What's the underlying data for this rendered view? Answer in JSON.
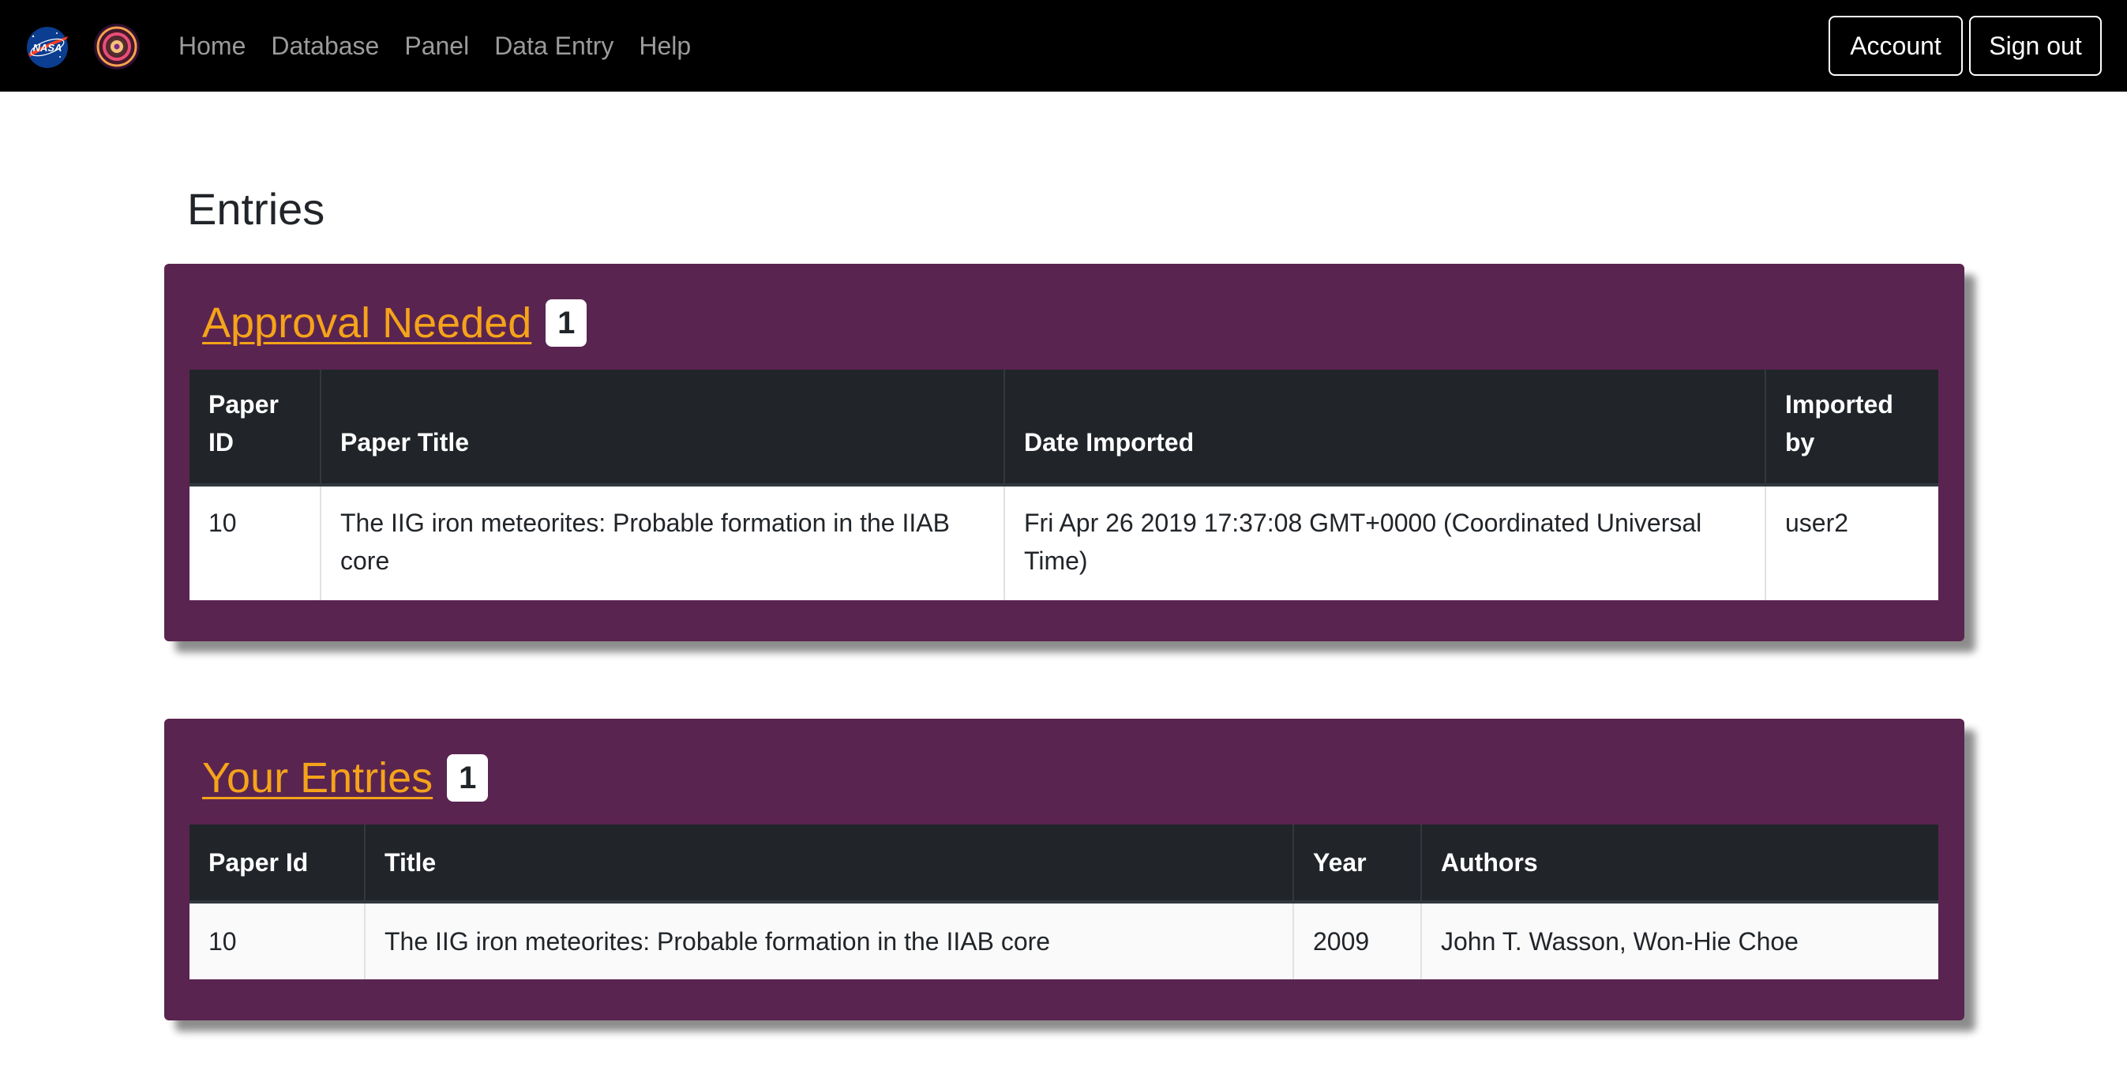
{
  "navbar": {
    "links": [
      "Home",
      "Database",
      "Panel",
      "Data Entry",
      "Help"
    ],
    "account_label": "Account",
    "signout_label": "Sign out"
  },
  "page": {
    "title": "Entries"
  },
  "approval": {
    "title": "Approval Needed",
    "count": "1",
    "columns": [
      "Paper ID",
      "Paper Title",
      "Date Imported",
      "Imported by"
    ],
    "rows": [
      [
        "10",
        "The IIG iron meteorites: Probable formation in the IIAB core",
        "Fri Apr 26 2019 17:37:08 GMT+0000 (Coordinated Universal Time)",
        "user2"
      ]
    ]
  },
  "your_entries": {
    "title": "Your Entries",
    "count": "1",
    "columns": [
      "Paper Id",
      "Title",
      "Year",
      "Authors"
    ],
    "rows": [
      [
        "10",
        "The IIG iron meteorites: Probable formation in the IIAB core",
        "2009",
        "John T. Wasson, Won-Hie Choe"
      ]
    ]
  },
  "colors": {
    "navbar": "#000000",
    "card_bg": "#5a2450",
    "card_title": "#f5a31a",
    "table_head": "#212529"
  }
}
